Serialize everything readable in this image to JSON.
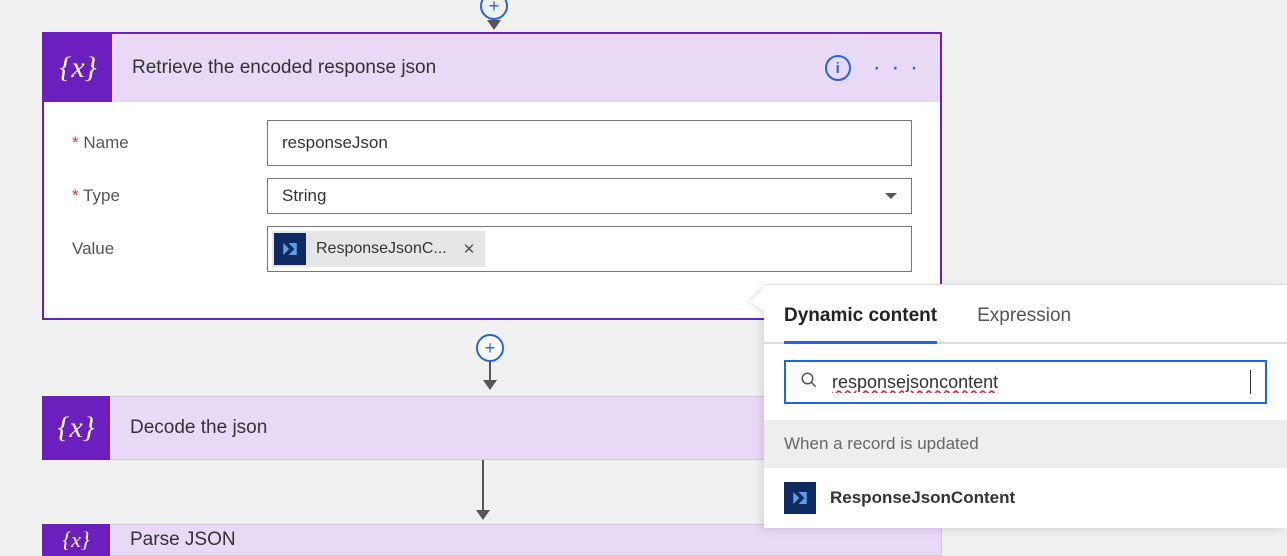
{
  "cards": {
    "retrieve": {
      "title": "Retrieve the encoded response json",
      "fields": {
        "name": {
          "label": "Name",
          "value": "responseJson",
          "required": true
        },
        "type": {
          "label": "Type",
          "value": "String",
          "required": true
        },
        "value": {
          "label": "Value",
          "token": "ResponseJsonC...",
          "required": false
        }
      },
      "addLink": "Add"
    },
    "decode": {
      "title": "Decode the json"
    },
    "parse": {
      "title": "Parse JSON"
    }
  },
  "popup": {
    "tabs": {
      "dynamic": "Dynamic content",
      "expression": "Expression"
    },
    "search": "responsejsoncontent",
    "section": "When a record is updated",
    "item": "ResponseJsonContent"
  }
}
